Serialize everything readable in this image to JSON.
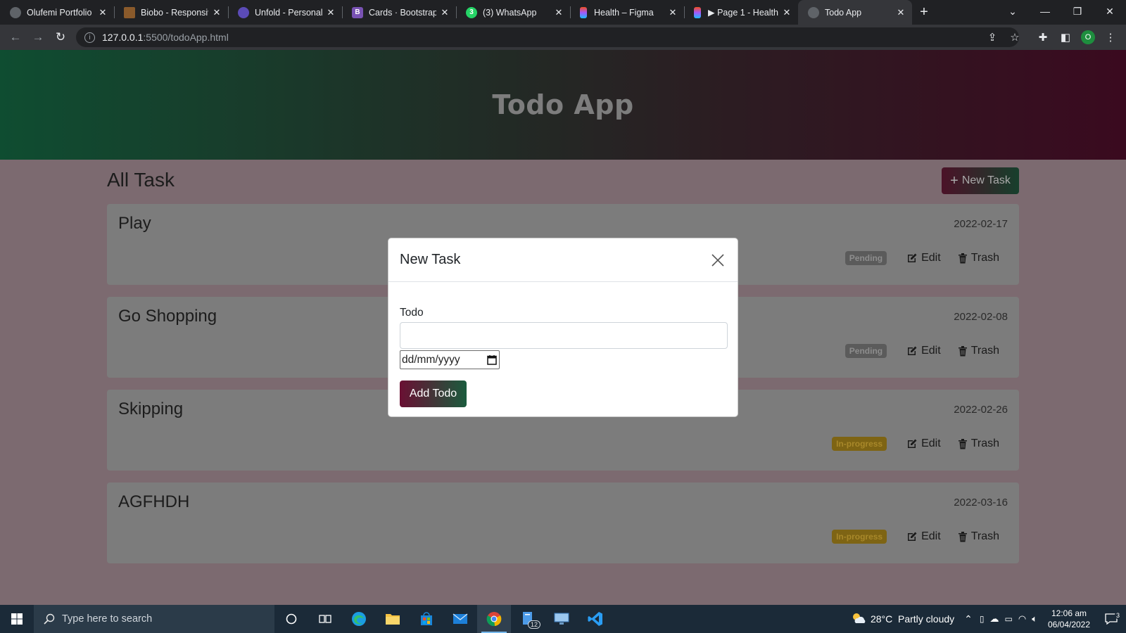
{
  "browser": {
    "tabs": [
      {
        "label": "Olufemi Portfolio",
        "fav_color": "#5f6368",
        "fav_char": ""
      },
      {
        "label": "Biobo - Responsive",
        "fav_color": "#8a5a2b",
        "fav_char": ""
      },
      {
        "label": "Unfold - Personal P",
        "fav_color": "#5b4bb7",
        "fav_char": ""
      },
      {
        "label": "Cards · Bootstrap v",
        "fav_color": "#7952b3",
        "fav_char": "B"
      },
      {
        "label": "(3) WhatsApp",
        "fav_color": "#25d366",
        "fav_char": "3"
      },
      {
        "label": "Health – Figma",
        "fav_color": "#f24e1e",
        "fav_char": ""
      },
      {
        "label": "▶ Page 1 - Health",
        "fav_color": "#a259ff",
        "fav_char": ""
      },
      {
        "label": "Todo App",
        "fav_color": "#5f6368",
        "fav_char": ""
      }
    ],
    "url_host": "127.0.0.1",
    "url_path": ":5500/todoApp.html",
    "profile_initial": "O"
  },
  "app": {
    "title": "Todo App",
    "section_title": "All Task",
    "new_task_label": "New Task",
    "tasks": [
      {
        "title": "Play",
        "date": "2022-02-17",
        "status": "Pending",
        "edit": "Edit",
        "trash": "Trash"
      },
      {
        "title": "Go Shopping",
        "date": "2022-02-08",
        "status": "Pending",
        "edit": "Edit",
        "trash": "Trash"
      },
      {
        "title": "Skipping",
        "date": "2022-02-26",
        "status": "In-progress",
        "edit": "Edit",
        "trash": "Trash"
      },
      {
        "title": "AGFHDH",
        "date": "2022-03-16",
        "status": "In-progress",
        "edit": "Edit",
        "trash": "Trash"
      }
    ]
  },
  "modal": {
    "title": "New Task",
    "todo_label": "Todo",
    "todo_value": "",
    "date_placeholder": "dd/mm/yyyy",
    "submit_label": "Add Todo"
  },
  "taskbar": {
    "search_placeholder": "Type here to search",
    "weather": "28°C  Partly cloudy",
    "time": "12:06 am",
    "date": "06/04/2022",
    "notification_count": "3",
    "badge_count": "12"
  },
  "colors": {
    "header_left": "#0f4d31",
    "header_right": "#3a0a1f",
    "pending": "#5b5b5b",
    "in_progress": "#7e6414"
  }
}
